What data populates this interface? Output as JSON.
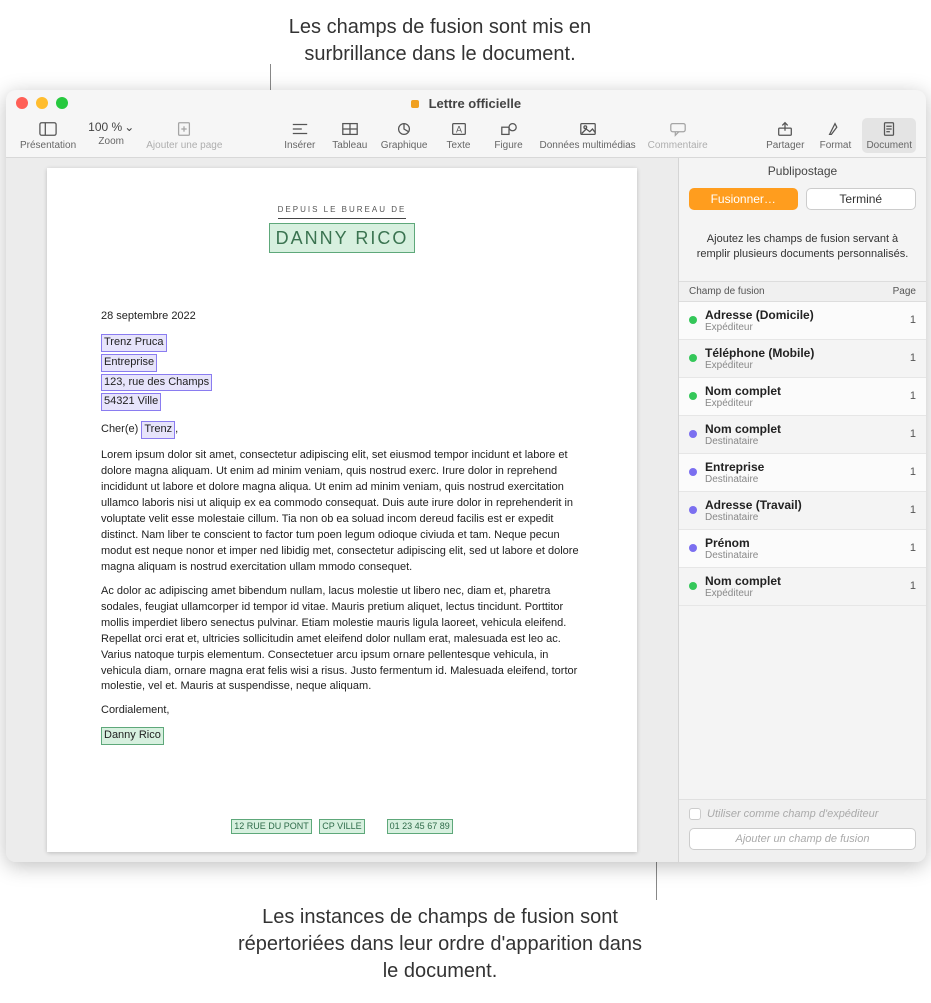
{
  "callouts": {
    "top": "Les champs de fusion sont mis en surbrillance dans le document.",
    "bottom": "Les instances de champs de fusion sont répertoriées dans leur ordre d'apparition dans le document."
  },
  "window": {
    "title": "Lettre officielle"
  },
  "toolbar": {
    "presentation": "Présentation",
    "zoom": "Zoom",
    "zoom_value": "100 %",
    "add_page": "Ajouter une page",
    "insert": "Insérer",
    "table": "Tableau",
    "chart": "Graphique",
    "text": "Texte",
    "shape": "Figure",
    "media": "Données multimédias",
    "comment": "Commentaire",
    "share": "Partager",
    "format": "Format",
    "document": "Document"
  },
  "letter": {
    "from_label": "DEPUIS LE BUREAU DE",
    "from_name": "DANNY RICO",
    "date": "28 septembre 2022",
    "recipient_name": "Trenz Pruca",
    "recipient_company": "Entreprise",
    "recipient_street": "123, rue des Champs",
    "recipient_city": "54321 Ville",
    "salutation_prefix": "Cher(e)",
    "salutation_name": "Trenz",
    "body1": "Lorem ipsum dolor sit amet, consectetur adipiscing elit, set eiusmod tempor incidunt et labore et dolore magna aliquam. Ut enim ad minim veniam, quis nostrud exerc. Irure dolor in reprehend incididunt ut labore et dolore magna aliqua. Ut enim ad minim veniam, quis nostrud exercitation ullamco laboris nisi ut aliquip ex ea commodo consequat. Duis aute irure dolor in reprehenderit in voluptate velit esse molestaie cillum. Tia non ob ea soluad incom dereud facilis est er expedit distinct. Nam liber te conscient to factor tum poen legum odioque civiuda et tam. Neque pecun modut est neque nonor et imper ned libidig met, consectetur adipiscing elit, sed ut labore et dolore magna aliquam is nostrud exercitation ullam mmodo consequet.",
    "body2": "Ac dolor ac adipiscing amet bibendum nullam, lacus molestie ut libero nec, diam et, pharetra sodales, feugiat ullamcorper id tempor id vitae. Mauris pretium aliquet, lectus tincidunt. Porttitor mollis imperdiet libero senectus pulvinar. Etiam molestie mauris ligula laoreet, vehicula eleifend. Repellat orci erat et, ultricies sollicitudin amet eleifend dolor nullam erat, malesuada est leo ac. Varius natoque turpis elementum. Consectetuer arcu ipsum ornare pellentesque vehicula, in vehicula diam, ornare magna erat felis wisi a risus. Justo fermentum id. Malesuada eleifend, tortor molestie, vel et. Mauris at suspendisse, neque aliquam.",
    "closing": "Cordialement,",
    "signature": "Danny Rico",
    "footer_addr": "12 RUE DU PONT",
    "footer_city": "CP VILLE",
    "footer_phone": "01 23 45 67 89"
  },
  "sidebar": {
    "title": "Publipostage",
    "merge_btn": "Fusionner…",
    "done_btn": "Terminé",
    "description": "Ajoutez les champs de fusion servant à remplir plusieurs documents personnalisés.",
    "col_field": "Champ de fusion",
    "col_page": "Page",
    "use_as_sender": "Utiliser comme champ d'expéditeur",
    "add_field": "Ajouter un champ de fusion",
    "fields": [
      {
        "name": "Adresse (Domicile)",
        "role": "Expéditeur",
        "color": "green",
        "page": "1"
      },
      {
        "name": "Téléphone (Mobile)",
        "role": "Expéditeur",
        "color": "green",
        "page": "1"
      },
      {
        "name": "Nom complet",
        "role": "Expéditeur",
        "color": "green",
        "page": "1"
      },
      {
        "name": "Nom complet",
        "role": "Destinataire",
        "color": "purple",
        "page": "1"
      },
      {
        "name": "Entreprise",
        "role": "Destinataire",
        "color": "purple",
        "page": "1"
      },
      {
        "name": "Adresse (Travail)",
        "role": "Destinataire",
        "color": "purple",
        "page": "1"
      },
      {
        "name": "Prénom",
        "role": "Destinataire",
        "color": "purple",
        "page": "1"
      },
      {
        "name": "Nom complet",
        "role": "Expéditeur",
        "color": "green",
        "page": "1"
      }
    ]
  }
}
